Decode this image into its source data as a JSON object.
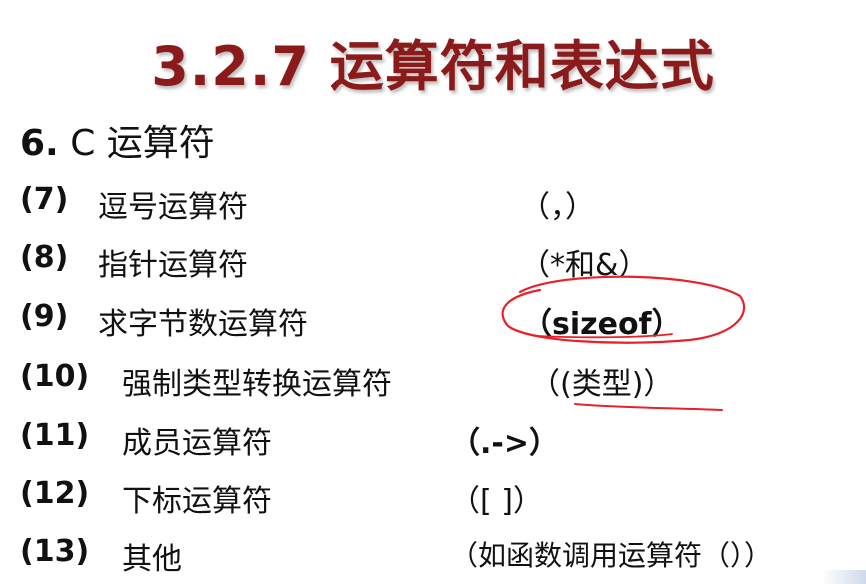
{
  "title": "3.2.7 运算符和表达式",
  "heading": {
    "num": "6.",
    "text": "C 运算符"
  },
  "rows": [
    {
      "num": "(7)",
      "name": "逗号运算符",
      "sym": "（，）"
    },
    {
      "num": "(8)",
      "name": "指针运算符",
      "sym": "（*和&）"
    },
    {
      "num": "(9)",
      "name": "求字节数运算符",
      "sym": "（sizeof）"
    },
    {
      "num": "(10)",
      "name": "强制类型转换运算符",
      "sym": "（(类型)）"
    },
    {
      "num": "(11)",
      "name": "成员运算符",
      "sym": "（.->）"
    },
    {
      "num": "(12)",
      "name": "下标运算符",
      "sym": "（[ ]）"
    },
    {
      "num": "(13)",
      "name": "其他",
      "sym": "（如函数调用运算符（））"
    }
  ],
  "colors": {
    "title": "#8b1a1a",
    "annotation": "#e8202a"
  }
}
